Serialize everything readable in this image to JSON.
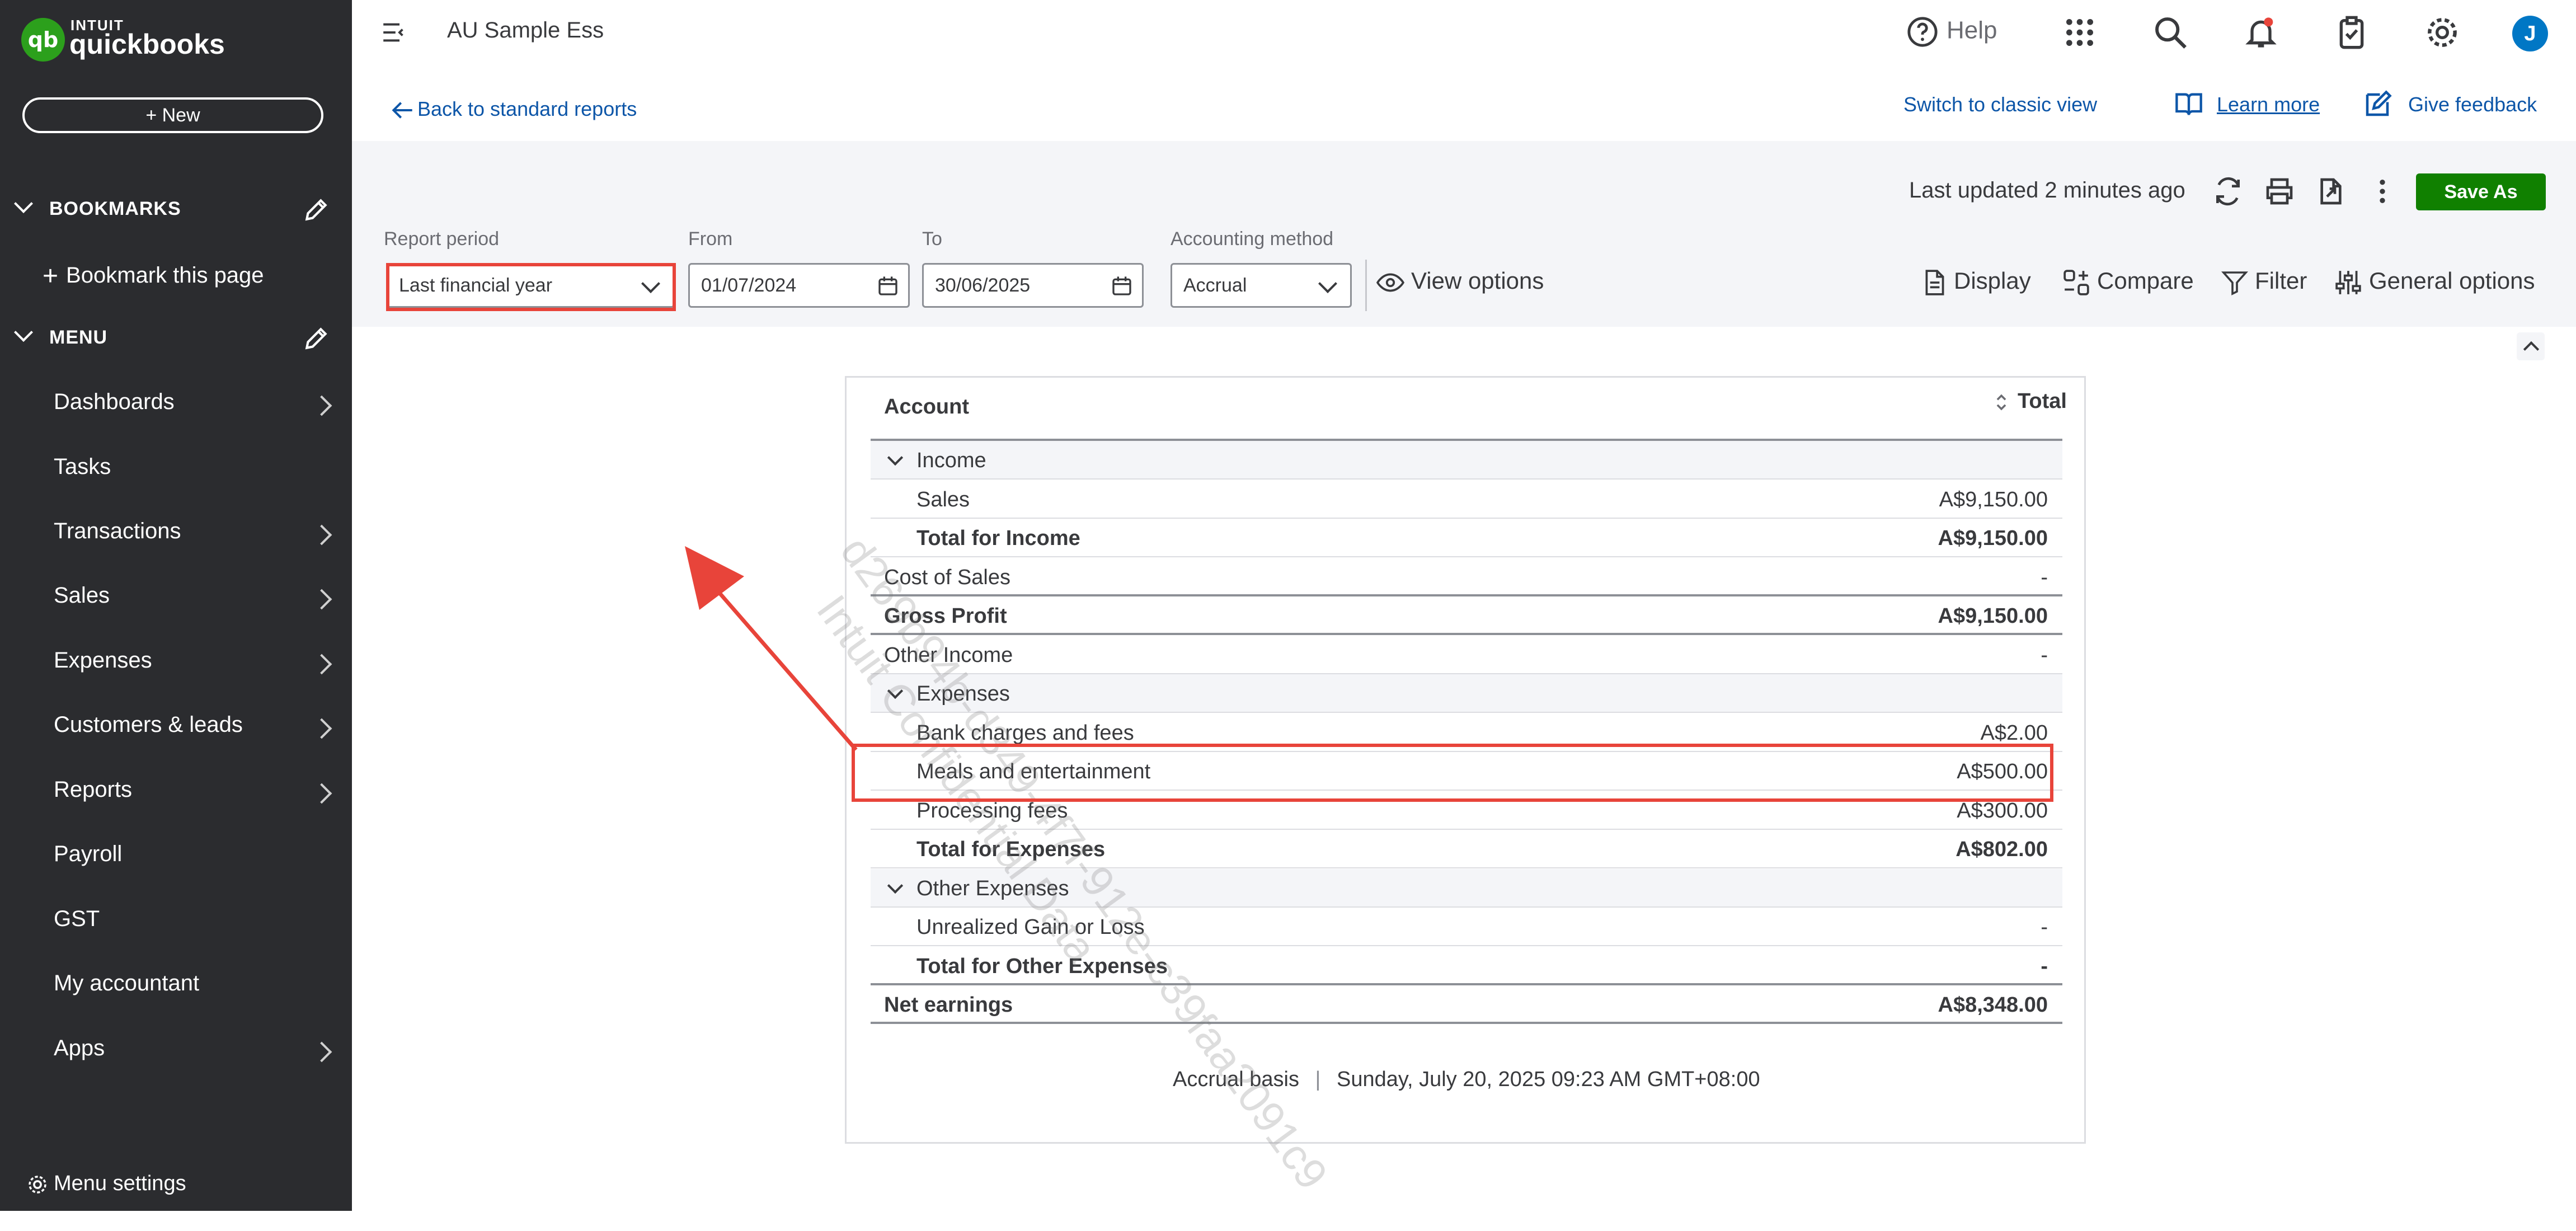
{
  "sidebar": {
    "logo_top": "INTUIT",
    "logo_bottom": "quickbooks",
    "logo_mark": "qb",
    "new_button": "+ New",
    "bookmarks_header": "BOOKMARKS",
    "bookmark_item": "Bookmark this page",
    "menu_header": "MENU",
    "items": [
      {
        "label": "Dashboards",
        "arrow": true
      },
      {
        "label": "Tasks",
        "arrow": false
      },
      {
        "label": "Transactions",
        "arrow": true
      },
      {
        "label": "Sales",
        "arrow": true
      },
      {
        "label": "Expenses",
        "arrow": true
      },
      {
        "label": "Customers & leads",
        "arrow": true
      },
      {
        "label": "Reports",
        "arrow": true
      },
      {
        "label": "Payroll",
        "arrow": false
      },
      {
        "label": "GST",
        "arrow": false
      },
      {
        "label": "My accountant",
        "arrow": false
      },
      {
        "label": "Apps",
        "arrow": true
      }
    ],
    "menu_settings": "Menu settings"
  },
  "header": {
    "company": "AU Sample Ess",
    "help": "Help",
    "avatar_initial": "J",
    "icons": [
      "menu-icon",
      "help-icon",
      "apps-grid-icon",
      "search-icon",
      "bell-icon",
      "clipboard-icon",
      "gear-icon"
    ]
  },
  "links": {
    "back": "Back to standard reports",
    "switch": "Switch to classic view",
    "learn": "Learn more",
    "feedback": "Give feedback"
  },
  "toolbar": {
    "report_period_label": "Report period",
    "report_period_value": "Last financial year",
    "from_label": "From",
    "from_value": "01/07/2024",
    "to_label": "To",
    "to_value": "30/06/2025",
    "method_label": "Accounting method",
    "method_value": "Accrual",
    "view_options": "View options",
    "last_updated": "Last updated 2 minutes ago",
    "save_as": "Save As",
    "display": "Display",
    "compare": "Compare",
    "filter": "Filter",
    "general_options": "General options"
  },
  "report": {
    "col_account": "Account",
    "col_total": "Total",
    "rows": [
      {
        "name": "Income",
        "value": "",
        "type": "group"
      },
      {
        "name": "Sales",
        "value": "A$9,150.00",
        "type": "child"
      },
      {
        "name": "Total for Income",
        "value": "A$9,150.00",
        "type": "subtotal"
      },
      {
        "name": "Cost of Sales",
        "value": "-",
        "type": "plain"
      },
      {
        "name": "Gross Profit",
        "value": "A$9,150.00",
        "type": "total"
      },
      {
        "name": "Other Income",
        "value": "-",
        "type": "plain"
      },
      {
        "name": "Expenses",
        "value": "",
        "type": "group"
      },
      {
        "name": "Bank charges and fees",
        "value": "A$2.00",
        "type": "child"
      },
      {
        "name": "Meals and entertainment",
        "value": "A$500.00",
        "type": "child"
      },
      {
        "name": "Processing fees",
        "value": "A$300.00",
        "type": "child"
      },
      {
        "name": "Total for Expenses",
        "value": "A$802.00",
        "type": "subtotal"
      },
      {
        "name": "Other Expenses",
        "value": "",
        "type": "group"
      },
      {
        "name": "Unrealized Gain or Loss",
        "value": "-",
        "type": "child"
      },
      {
        "name": "Total for Other Expenses",
        "value": "-",
        "type": "subtotal"
      },
      {
        "name": "Net earnings",
        "value": "A$8,348.00",
        "type": "total"
      }
    ],
    "footer_basis": "Accrual basis",
    "footer_date": "Sunday, July 20, 2025 09:23 AM GMT+08:00",
    "watermark_line1": "d269b94b-d349-4f7f-912e-c39faa2091c9",
    "watermark_line2": "Intuit Confidential Data"
  },
  "colors": {
    "sidebar_bg": "#2b2c2f",
    "brand_green": "#2ca01c",
    "save_green": "#108000",
    "link_blue": "#0d56a8",
    "annotation_red": "#e8443a"
  }
}
